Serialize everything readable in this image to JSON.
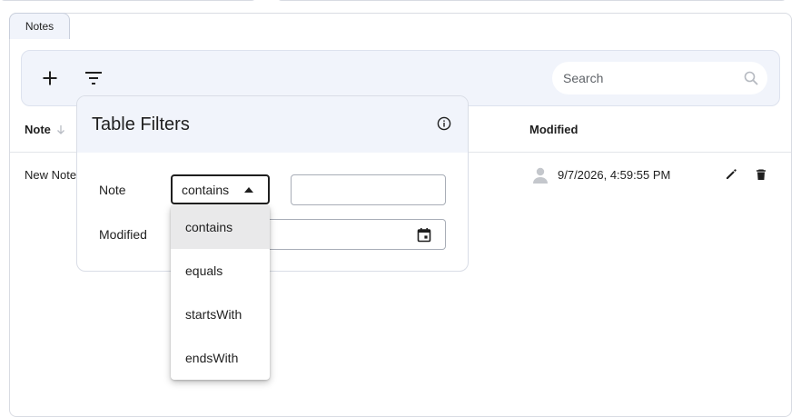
{
  "tab": {
    "label": "Notes"
  },
  "toolbar": {
    "add_icon": "plus-icon",
    "filter_icon": "filter-icon",
    "search_placeholder": "Search",
    "search_icon": "search-icon"
  },
  "table": {
    "columns": [
      {
        "label": "Note",
        "sort": "descending"
      },
      {
        "label": "Modified"
      }
    ],
    "rows": [
      {
        "note": "New Note",
        "modified": "9/7/2026, 4:59:55 PM",
        "avatar_icon": "person-icon"
      }
    ],
    "row_actions": [
      "edit-icon",
      "delete-icon"
    ]
  },
  "filters": {
    "title": "Table Filters",
    "info_icon": "info-icon",
    "fields": [
      {
        "label": "Note",
        "operator": "contains",
        "value": ""
      },
      {
        "label": "Modified",
        "value": ""
      }
    ],
    "operator_options": [
      "contains",
      "equals",
      "startsWith",
      "endsWith"
    ],
    "selected_option": "contains"
  },
  "colors": {
    "toolbar_bg": "#f1f4fb",
    "selected_option_bg": "#e9e9ea",
    "text": "#1f1f1f"
  }
}
